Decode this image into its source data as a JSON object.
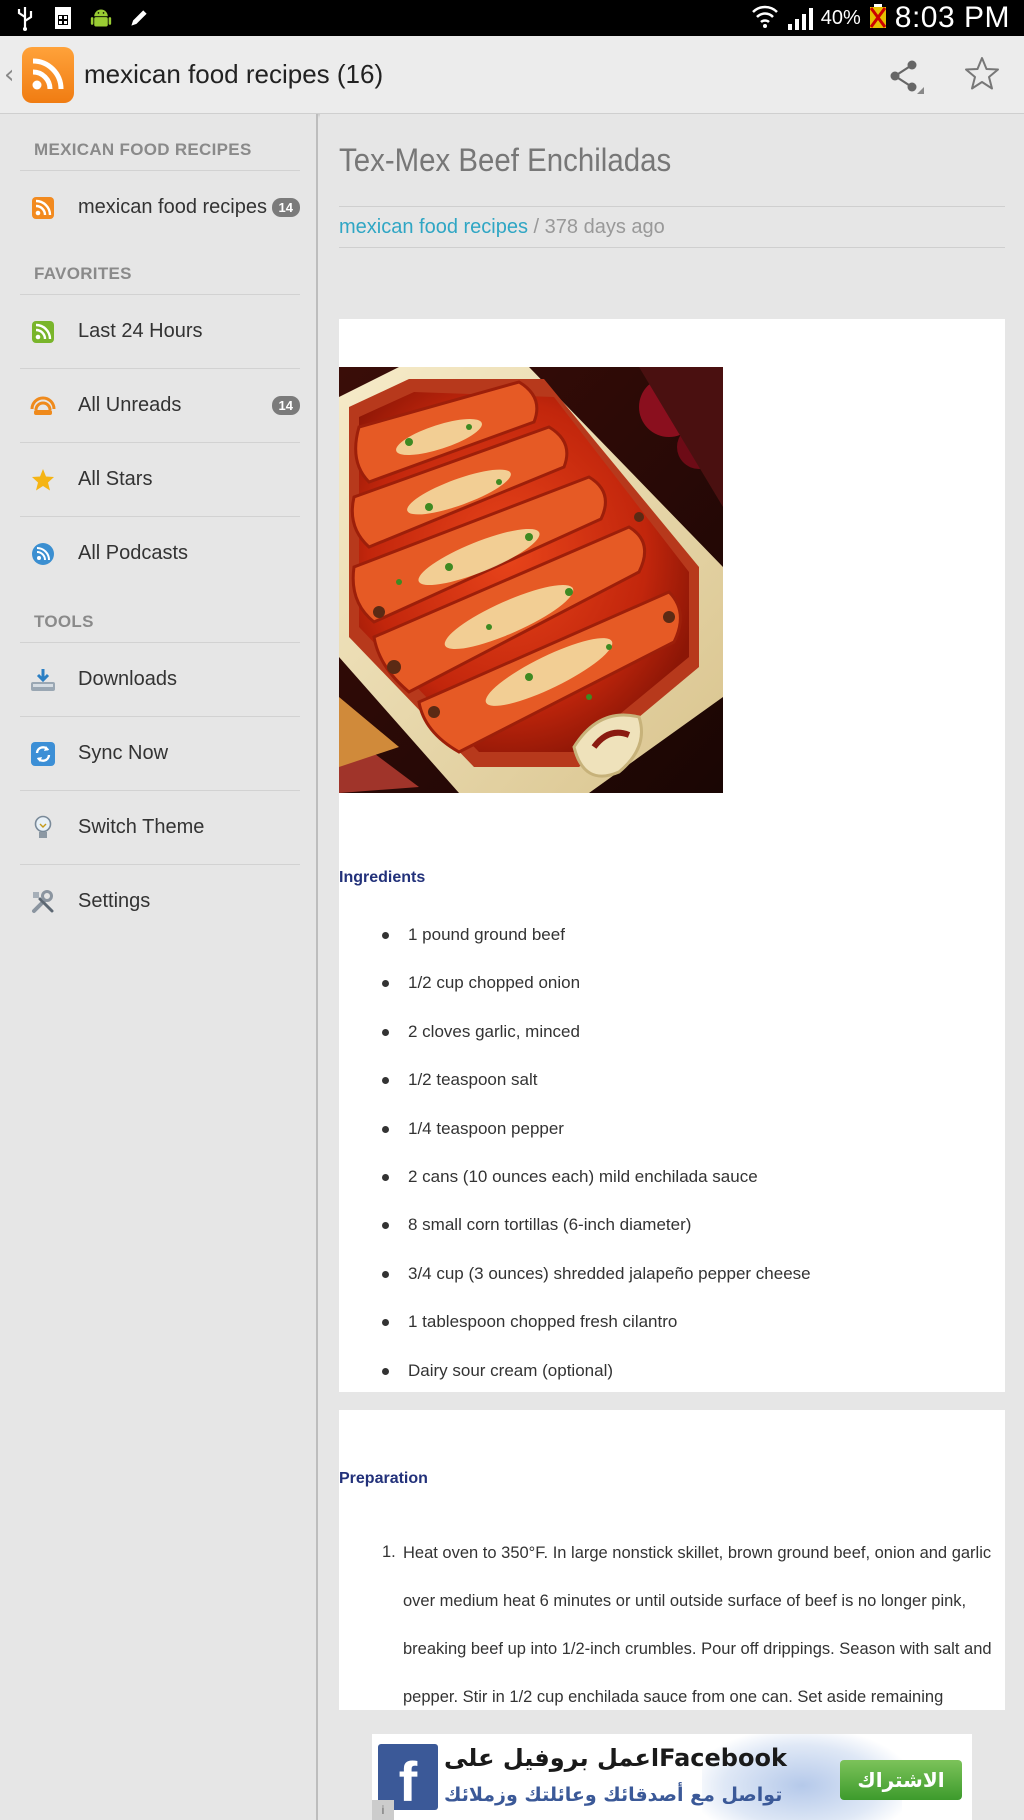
{
  "status_bar": {
    "battery": "40%",
    "time": "8:03 PM",
    "icons": [
      "usb-icon",
      "sim-icon",
      "android-icon",
      "pencil-icon",
      "wifi-icon",
      "signal-icon",
      "battery-icon"
    ]
  },
  "action_bar": {
    "title": "mexican food recipes (16)",
    "icons": [
      "rss-app-icon",
      "share-icon",
      "star-outline-icon"
    ]
  },
  "sidebar": {
    "section_feeds": "MEXICAN FOOD RECIPES",
    "feed": {
      "label": "mexican food recipes",
      "count": "14"
    },
    "section_favorites": "FAVORITES",
    "favorites": [
      {
        "label": "Last 24 Hours",
        "icon": "rss-green-icon"
      },
      {
        "label": "All Unreads",
        "icon": "unread-icon",
        "count": "14"
      },
      {
        "label": "All Stars",
        "icon": "star-icon"
      },
      {
        "label": "All Podcasts",
        "icon": "podcast-icon"
      }
    ],
    "section_tools": "TOOLS",
    "tools": [
      {
        "label": "Downloads",
        "icon": "download-icon"
      },
      {
        "label": "Sync Now",
        "icon": "sync-icon"
      },
      {
        "label": "Switch Theme",
        "icon": "lightbulb-icon"
      },
      {
        "label": "Settings",
        "icon": "settings-icon"
      }
    ]
  },
  "article": {
    "title": "Tex-Mex Beef Enchiladas",
    "feed_link": "mexican food recipes",
    "meta_suffix": " / 378 days ago",
    "ingredients_heading": "Ingredients",
    "ingredients": [
      "1 pound ground beef",
      "1/2 cup chopped onion",
      "2 cloves garlic, minced",
      "1/2 teaspoon salt",
      "1/4 teaspoon pepper",
      "2 cans (10 ounces each) mild enchilada sauce",
      "8 small corn tortillas (6-inch diameter)",
      "3/4 cup (3 ounces) shredded jalapeño pepper cheese",
      "1 tablespoon chopped fresh cilantro",
      "Dairy sour cream (optional)"
    ],
    "preparation_heading": "Preparation",
    "preparation_number": "1.",
    "preparation_step": "Heat oven to 350°F. In large nonstick skillet, brown ground beef, onion and garlic over medium heat 6 minutes or until outside surface of beef is no longer pink, breaking beef up into 1/2-inch crumbles. Pour off drippings. Season with salt and pepper. Stir in 1/2 cup enchilada sauce from one can. Set aside remaining"
  },
  "ad": {
    "logo": "f",
    "line1": "اعمل بروفيل علىFacebook",
    "line2": "تواصل مع أصدقائك وعائلتك وزملائك",
    "button": "الاشتراك"
  }
}
